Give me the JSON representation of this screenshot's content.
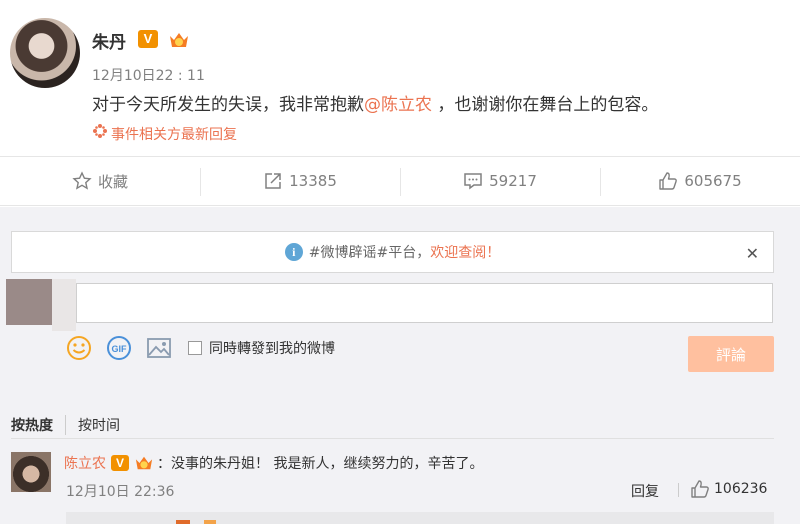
{
  "post": {
    "author": "朱丹",
    "verified_mark": "V",
    "time": "12月10日22 : 11",
    "text_before": "对于今天所发生的失误，我非常抱歉",
    "mention": "@陈立农",
    "text_after": " ，也谢谢你在舞台上的包容。",
    "related_link": "事件相关方最新回复"
  },
  "actions": {
    "favorite_label": "收藏",
    "repost_count": "13385",
    "comment_count": "59217",
    "like_count": "605675"
  },
  "notice": {
    "prefix": "#微博辟谣#平台，",
    "highlight": "欢迎查阅！",
    "close_glyph": "✕"
  },
  "composer": {
    "input_value": "",
    "repost_checkbox_label": "同時轉發到我的微博",
    "submit_label": "評論"
  },
  "sort": {
    "hot_label": "按热度",
    "time_label": "按时间"
  },
  "comment": {
    "user": "陈立农",
    "verified_mark": "V",
    "text": "：没事的朱丹姐！ 我是新人，继续努力的，辛苦了。",
    "time": "12月10日 22:36",
    "reply_label": "回复",
    "like_count": "106236"
  },
  "colors": {
    "accent": "#eb7350",
    "verified": "#f29100",
    "submit_disabled": "#ffc09f",
    "panel_bg": "#f2f2f5"
  },
  "icons": [
    "star-icon",
    "share-icon",
    "comment-icon",
    "thumbs-up-icon",
    "info-icon",
    "close-icon",
    "emoji-icon",
    "gif-icon",
    "image-icon",
    "sparkle-icon"
  ]
}
